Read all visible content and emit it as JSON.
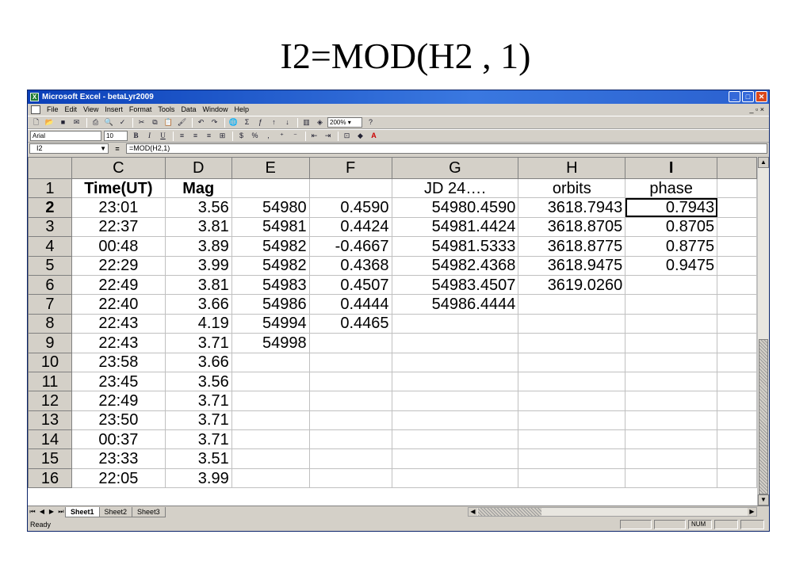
{
  "slide": {
    "title": "I2=MOD(H2 , 1)"
  },
  "window": {
    "title": "Microsoft Excel - betaLyr2009",
    "app_icon": "excel-icon",
    "buttons": {
      "minimize": "_",
      "maximize": "□",
      "close": "✕"
    }
  },
  "menubar": {
    "items": [
      "File",
      "Edit",
      "View",
      "Insert",
      "Format",
      "Tools",
      "Data",
      "Window",
      "Help"
    ],
    "right_controls": "_ ▫ ×"
  },
  "toolbar1": {
    "zoom": "200%",
    "zoom_arrow": "▾",
    "help": "?"
  },
  "toolbar2": {
    "font_name": "Arial",
    "font_size": "10",
    "bold": "B",
    "italic": "I",
    "underline": "U"
  },
  "formula_bar": {
    "cell_ref": "I2",
    "equals": "=",
    "formula": "=MOD(H2,1)"
  },
  "grid": {
    "columns": [
      "C",
      "D",
      "E",
      "F",
      "G",
      "H",
      "I",
      ""
    ],
    "active_column": "I",
    "active_row": "2",
    "rows": [
      {
        "num": "1",
        "cells": [
          "Time(UT)",
          "Mag",
          "",
          "",
          "JD 24….",
          "orbits",
          "phase",
          ""
        ]
      },
      {
        "num": "2",
        "cells": [
          "23:01",
          "3.56",
          "54980",
          "0.4590",
          "54980.4590",
          "3618.7943",
          "0.7943",
          ""
        ]
      },
      {
        "num": "3",
        "cells": [
          "22:37",
          "3.81",
          "54981",
          "0.4424",
          "54981.4424",
          "3618.8705",
          "0.8705",
          ""
        ]
      },
      {
        "num": "4",
        "cells": [
          "00:48",
          "3.89",
          "54982",
          "-0.4667",
          "54981.5333",
          "3618.8775",
          "0.8775",
          ""
        ]
      },
      {
        "num": "5",
        "cells": [
          "22:29",
          "3.99",
          "54982",
          "0.4368",
          "54982.4368",
          "3618.9475",
          "0.9475",
          ""
        ]
      },
      {
        "num": "6",
        "cells": [
          "22:49",
          "3.81",
          "54983",
          "0.4507",
          "54983.4507",
          "3619.0260",
          "",
          ""
        ]
      },
      {
        "num": "7",
        "cells": [
          "22:40",
          "3.66",
          "54986",
          "0.4444",
          "54986.4444",
          "",
          "",
          ""
        ]
      },
      {
        "num": "8",
        "cells": [
          "22:43",
          "4.19",
          "54994",
          "0.4465",
          "",
          "",
          "",
          ""
        ]
      },
      {
        "num": "9",
        "cells": [
          "22:43",
          "3.71",
          "54998",
          "",
          "",
          "",
          "",
          ""
        ]
      },
      {
        "num": "10",
        "cells": [
          "23:58",
          "3.66",
          "",
          "",
          "",
          "",
          "",
          ""
        ]
      },
      {
        "num": "11",
        "cells": [
          "23:45",
          "3.56",
          "",
          "",
          "",
          "",
          "",
          ""
        ]
      },
      {
        "num": "12",
        "cells": [
          "22:49",
          "3.71",
          "",
          "",
          "",
          "",
          "",
          ""
        ]
      },
      {
        "num": "13",
        "cells": [
          "23:50",
          "3.71",
          "",
          "",
          "",
          "",
          "",
          ""
        ]
      },
      {
        "num": "14",
        "cells": [
          "00:37",
          "3.71",
          "",
          "",
          "",
          "",
          "",
          ""
        ]
      },
      {
        "num": "15",
        "cells": [
          "23:33",
          "3.51",
          "",
          "",
          "",
          "",
          "",
          ""
        ]
      },
      {
        "num": "16",
        "cells": [
          "22:05",
          "3.99",
          "",
          "",
          "",
          "",
          "",
          ""
        ]
      }
    ]
  },
  "sheet_tabs": [
    "Sheet1",
    "Sheet2",
    "Sheet3"
  ],
  "active_sheet": "Sheet1",
  "status": {
    "text": "Ready",
    "num": "NUM"
  }
}
